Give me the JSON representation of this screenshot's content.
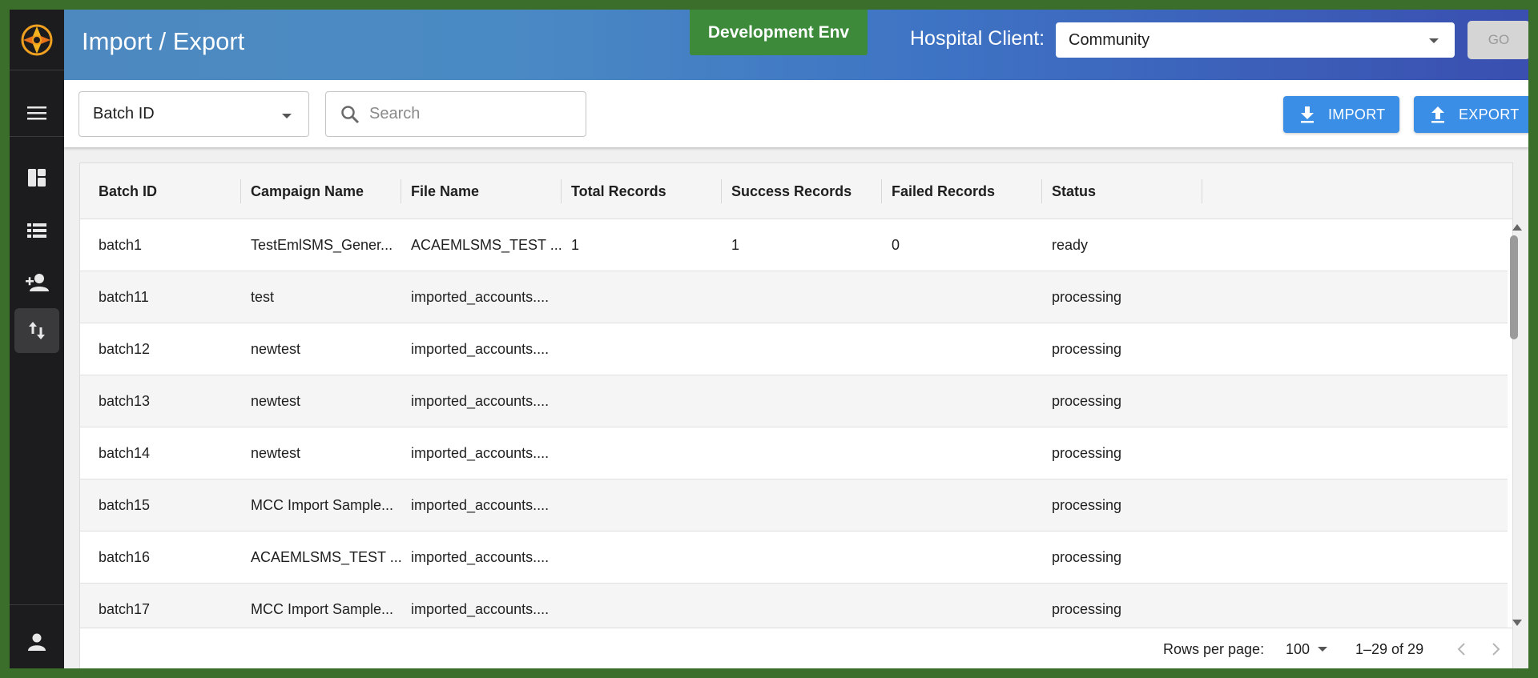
{
  "header": {
    "title": "Import / Export",
    "environment": "Development Env",
    "client_label": "Hospital Client:",
    "client_value": "Community",
    "go_label": "GO"
  },
  "toolbar": {
    "filter_field": "Batch ID",
    "search_placeholder": "Search",
    "import_label": "IMPORT",
    "export_label": "EXPORT"
  },
  "sidebar": {
    "items": [
      {
        "icon": "menu-icon"
      },
      {
        "icon": "dashboard-icon"
      },
      {
        "icon": "list-icon"
      },
      {
        "icon": "add-person-icon"
      },
      {
        "icon": "import-export-icon",
        "active": true
      },
      {
        "icon": "account-icon"
      }
    ]
  },
  "table": {
    "columns": [
      "Batch ID",
      "Campaign Name",
      "File Name",
      "Total Records",
      "Success Records",
      "Failed Records",
      "Status"
    ],
    "rows": [
      {
        "batch": "batch1",
        "campaign": "TestEmlSMS_Gener...",
        "file": "ACAEMLSMS_TEST ...",
        "total": "1",
        "success": "1",
        "failed": "0",
        "status": "ready"
      },
      {
        "batch": "batch11",
        "campaign": "test",
        "file": "imported_accounts....",
        "total": "",
        "success": "",
        "failed": "",
        "status": "processing"
      },
      {
        "batch": "batch12",
        "campaign": "newtest",
        "file": "imported_accounts....",
        "total": "",
        "success": "",
        "failed": "",
        "status": "processing"
      },
      {
        "batch": "batch13",
        "campaign": "newtest",
        "file": "imported_accounts....",
        "total": "",
        "success": "",
        "failed": "",
        "status": "processing"
      },
      {
        "batch": "batch14",
        "campaign": "newtest",
        "file": "imported_accounts....",
        "total": "",
        "success": "",
        "failed": "",
        "status": "processing"
      },
      {
        "batch": "batch15",
        "campaign": "MCC Import Sample...",
        "file": "imported_accounts....",
        "total": "",
        "success": "",
        "failed": "",
        "status": "processing"
      },
      {
        "batch": "batch16",
        "campaign": "ACAEMLSMS_TEST ...",
        "file": "imported_accounts....",
        "total": "",
        "success": "",
        "failed": "",
        "status": "processing"
      },
      {
        "batch": "batch17",
        "campaign": "MCC Import Sample...",
        "file": "imported_accounts....",
        "total": "",
        "success": "",
        "failed": "",
        "status": "processing"
      }
    ]
  },
  "pagination": {
    "rows_per_page_label": "Rows per page:",
    "rows_per_page": "100",
    "range": "1–29 of 29"
  },
  "colors": {
    "accent": "#3a8ee6",
    "env_badge": "#3c8a3a",
    "sidebar": "#1c1c1e"
  }
}
